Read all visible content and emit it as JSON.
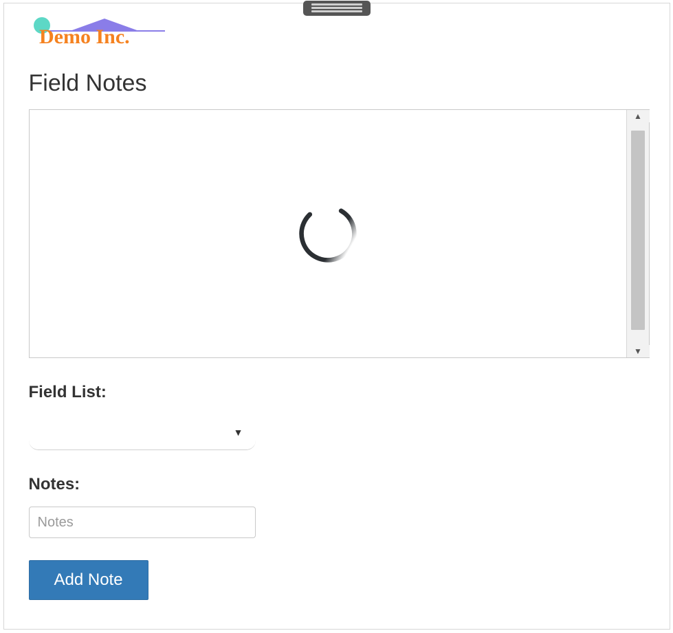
{
  "logo": {
    "text": "Demo Inc.",
    "colors": {
      "text": "#f58220",
      "roof": "#8a7de8",
      "dot": "#5dd8c6"
    }
  },
  "page": {
    "title": "Field Notes"
  },
  "map": {
    "loading": true
  },
  "form": {
    "field_list": {
      "label": "Field List:",
      "selected": ""
    },
    "notes": {
      "label": "Notes:",
      "placeholder": "Notes",
      "value": ""
    },
    "add_button": "Add Note"
  }
}
